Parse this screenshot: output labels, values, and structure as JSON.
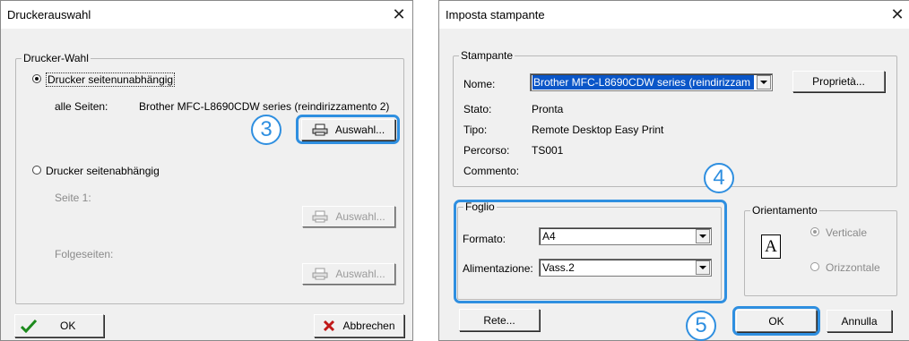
{
  "left_dialog": {
    "title": "Druckerauswahl",
    "group_title": "Drucker-Wahl",
    "radio_independent": "Drucker seitenunabhängig",
    "all_pages_label": "alle Seiten:",
    "printer_value": "Brother MFC-L8690CDW series (reindirizzamento 2)",
    "select_button": "Auswahl...",
    "radio_dependent": "Drucker seitenabhängig",
    "page1_label": "Seite 1:",
    "page1_select_button": "Auswahl...",
    "following_label": "Folgeseiten:",
    "following_select_button": "Auswahl...",
    "ok_button": "OK",
    "cancel_button": "Abbrechen"
  },
  "right_dialog": {
    "title": "Imposta stampante",
    "printer_group": "Stampante",
    "name_label": "Nome:",
    "name_value": "Brother MFC-L8690CDW series (reindirizzam",
    "properties_button": "Proprietà...",
    "status_label": "Stato:",
    "status_value": "Pronta",
    "type_label": "Tipo:",
    "type_value": "Remote Desktop Easy Print",
    "path_label": "Percorso:",
    "path_value": "TS001",
    "comment_label": "Commento:",
    "comment_value": "",
    "paper_group": "Foglio",
    "format_label": "Formato:",
    "format_value": "A4",
    "feed_label": "Alimentazione:",
    "feed_value": "Vass.2",
    "orientation_group": "Orientamento",
    "orientation_icon_letter": "A",
    "portrait": "Verticale",
    "landscape": "Orizzontale",
    "network_button": "Rete...",
    "ok_button": "OK",
    "cancel_button": "Annulla"
  },
  "annotations": {
    "step_3": "3",
    "step_4": "4",
    "step_5": "5",
    "highlight_color": "#2f8fe0"
  }
}
